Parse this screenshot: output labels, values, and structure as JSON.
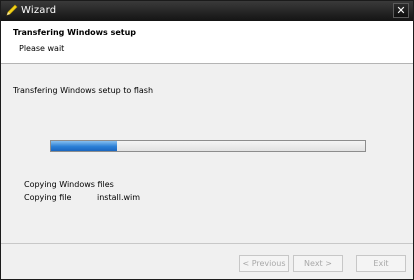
{
  "window": {
    "title": "Wizard",
    "close_glyph": "✕"
  },
  "header": {
    "title": "Transfering Windows setup",
    "subtitle": "Please wait"
  },
  "main": {
    "section_label": "Transfering Windows setup to flash",
    "progress_fraction": 0.21,
    "status_line_1": "Copying Windows files",
    "status_line_2_label": "Copying file",
    "status_line_2_value": "install.wim"
  },
  "footer": {
    "back_label": "< Previous",
    "next_label": "Next >",
    "exit_label": "Exit"
  },
  "colors": {
    "titlebar": "#1a1a1a",
    "progress_fill": "#2b7fd6",
    "disabled_text": "#a8a8a8"
  },
  "icons": {
    "app": "pencil-icon",
    "close": "close-icon"
  }
}
